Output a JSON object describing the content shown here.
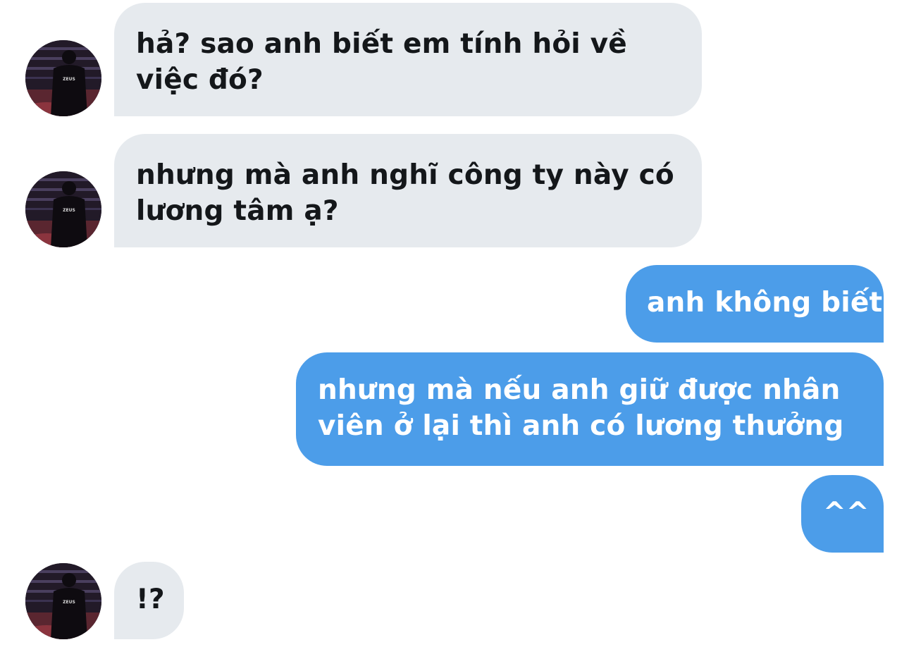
{
  "conversation": {
    "messages": [
      {
        "side": "received",
        "text": "hả? sao anh biết em tính hỏi về việc đó?"
      },
      {
        "side": "received",
        "text": "nhưng mà anh nghĩ công ty này có lương tâm ạ?"
      },
      {
        "side": "sent",
        "text": "anh không biết"
      },
      {
        "side": "sent",
        "text": "nhưng mà nếu anh giữ được nhân viên ở lại thì anh có lương thưởng"
      },
      {
        "side": "sent",
        "text": "^^"
      },
      {
        "side": "received",
        "text": "!?"
      }
    ],
    "avatar": {
      "shirt_text": "ZEUS",
      "icon": "user-avatar-icon"
    }
  },
  "colors": {
    "received_bubble": "#e6eaee",
    "sent_bubble": "#4c9de9",
    "received_text": "#14171a",
    "sent_text": "#ffffff",
    "background": "#ffffff"
  }
}
